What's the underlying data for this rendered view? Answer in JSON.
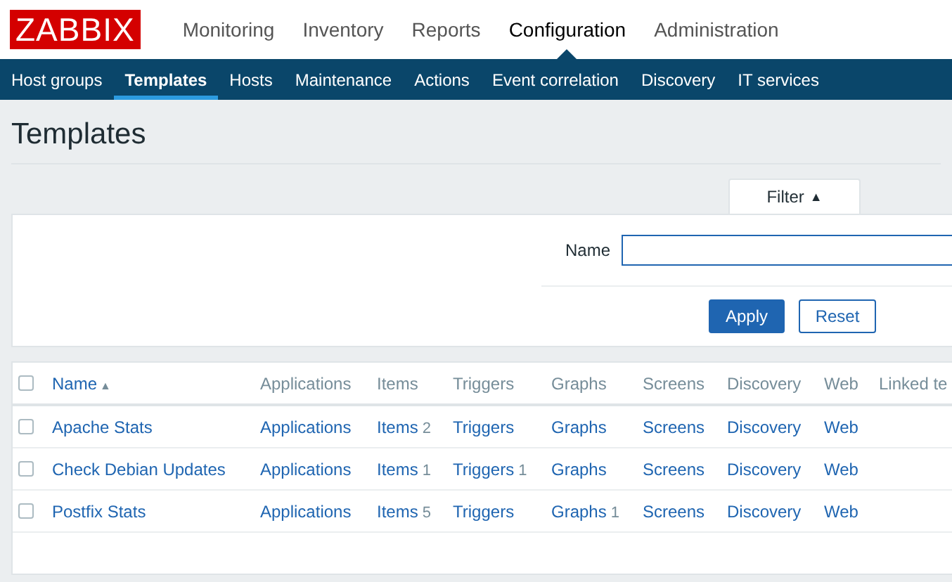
{
  "logo": "ZABBIX",
  "main_menu": [
    {
      "label": "Monitoring",
      "selected": false
    },
    {
      "label": "Inventory",
      "selected": false
    },
    {
      "label": "Reports",
      "selected": false
    },
    {
      "label": "Configuration",
      "selected": true
    },
    {
      "label": "Administration",
      "selected": false
    }
  ],
  "sub_menu": [
    {
      "label": "Host groups",
      "selected": false
    },
    {
      "label": "Templates",
      "selected": true
    },
    {
      "label": "Hosts",
      "selected": false
    },
    {
      "label": "Maintenance",
      "selected": false
    },
    {
      "label": "Actions",
      "selected": false
    },
    {
      "label": "Event correlation",
      "selected": false
    },
    {
      "label": "Discovery",
      "selected": false
    },
    {
      "label": "IT services",
      "selected": false
    }
  ],
  "page_title": "Templates",
  "filter": {
    "tab_label": "Filter",
    "tab_arrow": "▲",
    "expanded": true,
    "name_label": "Name",
    "buttons": [
      {
        "label": "Apply",
        "kind": "primary"
      },
      {
        "label": "Reset",
        "kind": "secondary"
      }
    ]
  },
  "table": {
    "select_all_checked": false,
    "columns": [
      {
        "label": "Name",
        "sort_indicator": "▲",
        "link": true
      },
      {
        "label": "Applications",
        "link": false
      },
      {
        "label": "Items",
        "link": false
      },
      {
        "label": "Triggers",
        "link": false
      },
      {
        "label": "Graphs",
        "link": false
      },
      {
        "label": "Screens",
        "link": false
      },
      {
        "label": "Discovery",
        "link": false
      },
      {
        "label": "Web",
        "link": false
      },
      {
        "label": "Linked te",
        "link": false
      }
    ],
    "rows": [
      {
        "checked": false,
        "cells": [
          {
            "label": "Apache Stats"
          },
          {
            "label": "Applications"
          },
          {
            "label": "Items",
            "count": "2"
          },
          {
            "label": "Triggers"
          },
          {
            "label": "Graphs"
          },
          {
            "label": "Screens"
          },
          {
            "label": "Discovery"
          },
          {
            "label": "Web"
          }
        ]
      },
      {
        "checked": false,
        "cells": [
          {
            "label": "Check Debian Updates"
          },
          {
            "label": "Applications"
          },
          {
            "label": "Items",
            "count": "1"
          },
          {
            "label": "Triggers",
            "count": "1"
          },
          {
            "label": "Graphs"
          },
          {
            "label": "Screens"
          },
          {
            "label": "Discovery"
          },
          {
            "label": "Web"
          }
        ]
      },
      {
        "checked": false,
        "cells": [
          {
            "label": "Postfix Stats"
          },
          {
            "label": "Applications"
          },
          {
            "label": "Items",
            "count": "5"
          },
          {
            "label": "Triggers"
          },
          {
            "label": "Graphs",
            "count": "1"
          },
          {
            "label": "Screens"
          },
          {
            "label": "Discovery"
          },
          {
            "label": "Web"
          }
        ]
      }
    ]
  }
}
